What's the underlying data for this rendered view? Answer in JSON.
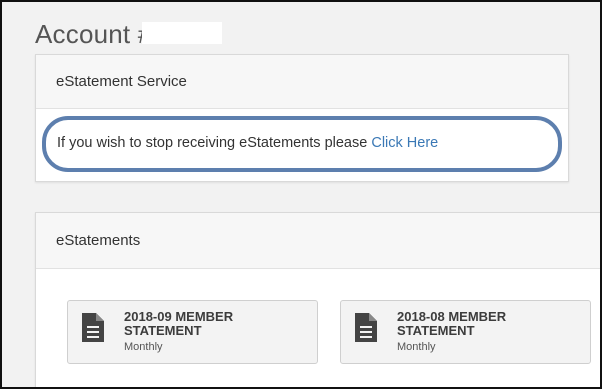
{
  "page": {
    "title": "Account #"
  },
  "service_panel": {
    "heading": "eStatement Service",
    "message": "If you wish to stop receiving eStatements please ",
    "link": "Click Here",
    "highlight_color": "#5d7fae",
    "link_color": "#3a78b5"
  },
  "statements_panel": {
    "heading": "eStatements",
    "items": [
      {
        "title": "2018-09 MEMBER STATEMENT",
        "frequency": "Monthly",
        "icon": "document-icon"
      },
      {
        "title": "2018-08 MEMBER STATEMENT",
        "frequency": "Monthly",
        "icon": "document-icon"
      }
    ]
  }
}
